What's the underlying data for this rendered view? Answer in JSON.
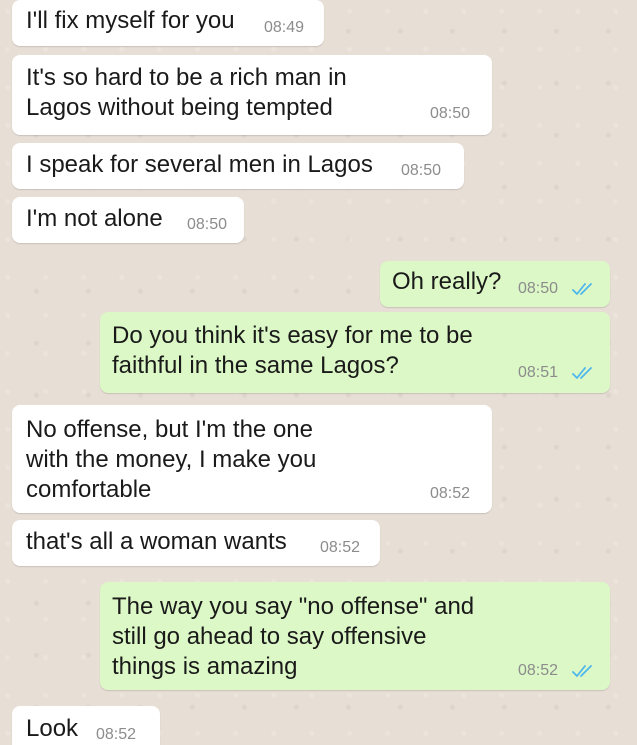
{
  "colors": {
    "chat_background": "#e7ded5",
    "incoming_bubble": "#ffffff",
    "outgoing_bubble": "#dcf8c6",
    "timestamp": "#8c8c8c",
    "read_ticks": "#4fb6ec"
  },
  "messages": [
    {
      "direction": "incoming",
      "text": "I'll fix myself for you",
      "time": "08:49"
    },
    {
      "direction": "incoming",
      "text": "It's so hard to be a rich man in\nLagos without being tempted",
      "time": "08:50"
    },
    {
      "direction": "incoming",
      "text": "I speak for several men in Lagos",
      "time": "08:50"
    },
    {
      "direction": "incoming",
      "text": "I'm not alone",
      "time": "08:50"
    },
    {
      "direction": "outgoing",
      "text": "Oh really?",
      "time": "08:50",
      "status_icon": "double-check-read-icon"
    },
    {
      "direction": "outgoing",
      "text": "Do you think it's easy for me to be\nfaithful in the same Lagos?",
      "time": "08:51",
      "status_icon": "double-check-read-icon"
    },
    {
      "direction": "incoming",
      "text": "No offense, but I'm the one\nwith the money, I make you\ncomfortable",
      "time": "08:52"
    },
    {
      "direction": "incoming",
      "text": "that's all a woman wants",
      "time": "08:52"
    },
    {
      "direction": "outgoing",
      "text": "The way you say \"no offense\" and\nstill go ahead to say offensive\nthings is amazing",
      "time": "08:52",
      "status_icon": "double-check-read-icon"
    },
    {
      "direction": "incoming",
      "text": "Look",
      "time": "08:52"
    }
  ]
}
